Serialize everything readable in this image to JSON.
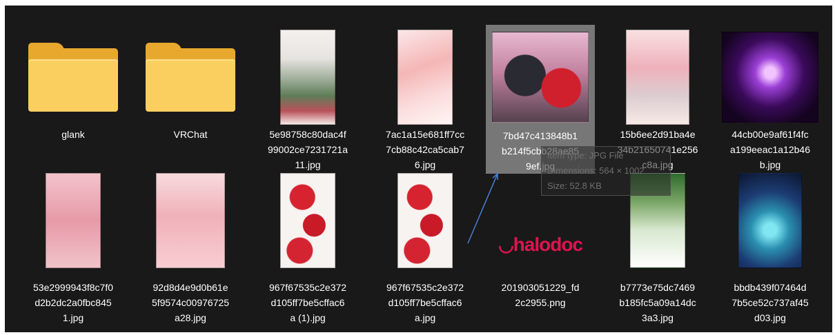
{
  "files": [
    {
      "name": "glank",
      "type": "folder"
    },
    {
      "name": "VRChat",
      "type": "folder"
    },
    {
      "name": "5e98758c80dac4f\n99002ce7231721a\n11.jpg",
      "type": "image"
    },
    {
      "name": "7ac1a15e681ff7cc\n7cb88c42ca5cab7\n6.jpg",
      "type": "image"
    },
    {
      "name": "7bd47c413848b1\nb214f5cbb28ae85\n9ef.jpg",
      "type": "image",
      "selected": true
    },
    {
      "name": "15b6ee2d91ba4e\n34b21650741e256\nc8a.jpg",
      "type": "image"
    },
    {
      "name": "44cb00e9af61f4fc\na199eeac1a12b46\nb.jpg",
      "type": "image"
    },
    {
      "name": "53e2999943f8c7f0\nd2b2dc2a0fbc845\n1.jpg",
      "type": "image"
    },
    {
      "name": "92d8d4e9d0b61e\n5f9574c00976725\na28.jpg",
      "type": "image"
    },
    {
      "name": "967f67535c2e372\nd105ff7be5cffac6\na (1).jpg",
      "type": "image"
    },
    {
      "name": "967f67535c2e372\nd105ff7be5cffac6\na.jpg",
      "type": "image"
    },
    {
      "name": "201903051229_fd\n2c2955.png",
      "type": "image",
      "logo_text": "halodoc"
    },
    {
      "name": "b7773e75dc7469\nb185fc5a09a14dc\n3a3.jpg",
      "type": "image"
    },
    {
      "name": "bbdb439f07464d\n7b5ce52c737af45\nd03.jpg",
      "type": "image"
    }
  ],
  "tooltip": {
    "type_line": "Item type: JPG File",
    "dimensions_line": "Dimensions: 564 × 1002",
    "size_line": "Size: 52.8 KB"
  },
  "colors": {
    "background": "#191919",
    "selection": "#777777",
    "folder": "#fbcf5f",
    "logo": "#e0134f"
  }
}
